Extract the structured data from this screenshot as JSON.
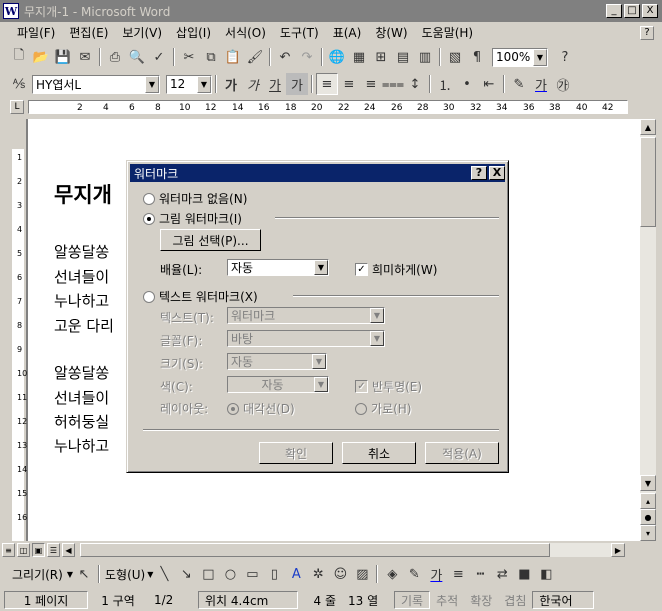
{
  "window": {
    "title": "무지개-1 - Microsoft Word",
    "app_icon": "W",
    "buttons": {
      "minimize": "_",
      "maximize": "□",
      "close": "X"
    }
  },
  "menubar": {
    "items": [
      "파일(F)",
      "편집(E)",
      "보기(V)",
      "삽입(I)",
      "서식(O)",
      "도구(T)",
      "표(A)",
      "창(W)",
      "도움말(H)"
    ],
    "help_box": "?"
  },
  "toolbar_standard": {
    "zoom": "100%"
  },
  "toolbar_format": {
    "font": "HY엽서L",
    "size": "12",
    "style_glyphs": [
      "가",
      "가",
      "가",
      "가"
    ]
  },
  "ruler": {
    "ticks": [
      "2",
      "4",
      "6",
      "8",
      "10",
      "12",
      "14",
      "16",
      "18",
      "20",
      "22",
      "24",
      "26",
      "28",
      "30",
      "32",
      "34",
      "36",
      "38",
      "40",
      "42"
    ],
    "corner": "L"
  },
  "vruler": {
    "ticks": [
      "1",
      "2",
      "3",
      "4",
      "5",
      "6",
      "7",
      "8",
      "9",
      "10",
      "11",
      "12",
      "13",
      "14",
      "15",
      "16"
    ]
  },
  "document": {
    "title": "무지개",
    "lines": [
      "알쏭달쏭",
      "선녀들이",
      "누나하고",
      "고운 다리",
      "알쏭달쏭",
      "선녀들이",
      "허허둥실",
      "누나하고"
    ]
  },
  "dialog": {
    "title": "워터마크",
    "help_btn": "?",
    "close_btn": "X",
    "no_watermark": "워터마크 없음(N)",
    "picture_watermark": "그림 워터마크(I)",
    "select_picture": "그림 선택(P)...",
    "scale_label": "배율(L):",
    "scale_value": "자동",
    "washout_label": "희미하게(W)",
    "text_watermark": "텍스트 워터마크(X)",
    "text_label": "텍스트(T):",
    "text_value": "워터마크",
    "font_label": "글꼴(F):",
    "font_value": "바탕",
    "size_label": "크기(S):",
    "size_value": "자동",
    "color_label": "색(C):",
    "color_value": "자동",
    "semitransparent_label": "반투명(E)",
    "layout_label": "레이아웃:",
    "diagonal_label": "대각선(D)",
    "horizontal_label": "가로(H)",
    "ok": "확인",
    "cancel": "취소",
    "apply": "적용(A)"
  },
  "drawbar": {
    "draw_label": "그리기(R)",
    "autoshapes_label": "도형(U)",
    "text_glyph": "가"
  },
  "statusbar": {
    "page": "1 페이지",
    "section": "1 구역",
    "page_of": "1/2",
    "position": "위치 4.4cm",
    "line": "4 줄",
    "column": "13 열",
    "rec": "기록",
    "trk": "추적",
    "ext": "확장",
    "ovr": "겹침",
    "language": "한국어"
  },
  "colors": {
    "title_active": "#0a246a",
    "title_inactive": "#808080",
    "face": "#d4d0c8"
  }
}
